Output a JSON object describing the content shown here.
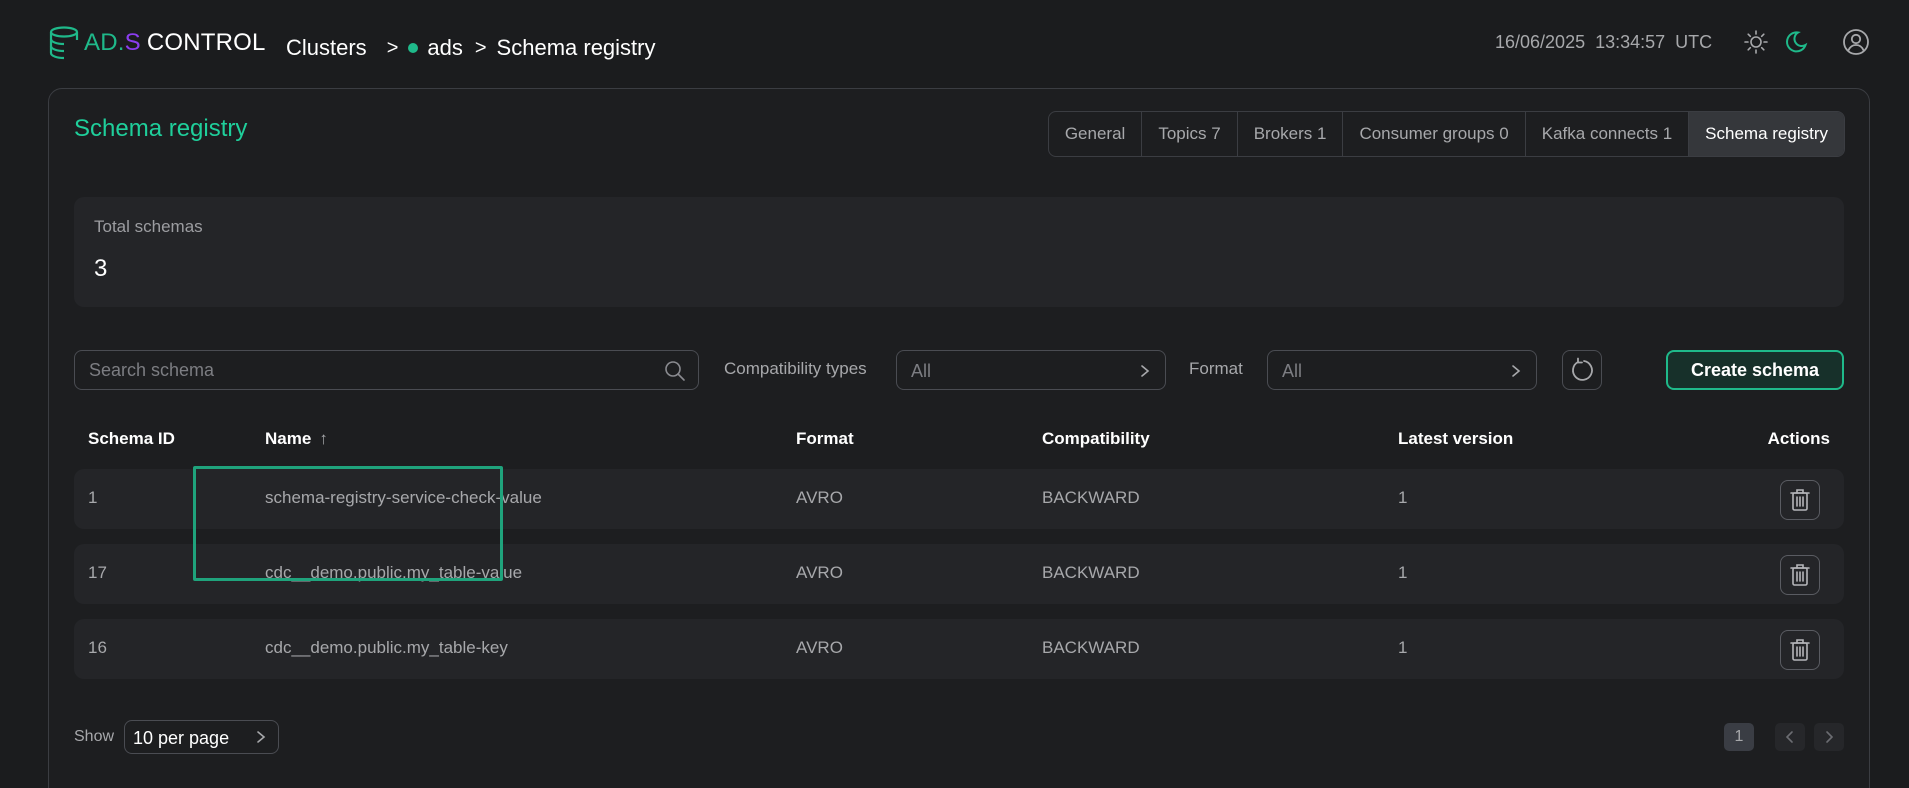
{
  "header": {
    "logo": {
      "ad": "AD.",
      "s": "S",
      "control": "CONTROL"
    },
    "breadcrumb": [
      {
        "label": "Clusters"
      },
      {
        "sep": ">"
      },
      {
        "label": "ads"
      },
      {
        "sep": ">"
      },
      {
        "label": "Schema registry"
      }
    ],
    "date": "16/06/2025",
    "time": "13:34:57",
    "tz": "UTC",
    "icons": [
      "sun-icon",
      "moon-icon",
      "user-icon"
    ]
  },
  "page": {
    "title": "Schema registry"
  },
  "tabs": [
    {
      "label": "General",
      "active": false
    },
    {
      "label": "Topics 7",
      "active": false
    },
    {
      "label": "Brokers 1",
      "active": false
    },
    {
      "label": "Consumer groups 0",
      "active": false
    },
    {
      "label": "Kafka connects 1",
      "active": false
    },
    {
      "label": "Schema registry",
      "active": true
    }
  ],
  "summary": {
    "label": "Total schemas",
    "value": "3"
  },
  "filters": {
    "search_placeholder": "Search schema",
    "compat_label": "Compatibility types",
    "compat_value": "All",
    "format_label": "Format",
    "format_value": "All",
    "create_label": "Create schema"
  },
  "table": {
    "headers": {
      "id": "Schema ID",
      "name": "Name",
      "sort_arrow": "↑",
      "format": "Format",
      "compat": "Compatibility",
      "version": "Latest version",
      "actions": "Actions"
    },
    "rows": [
      {
        "id": "1",
        "name": "schema-registry-service-check-value",
        "format": "AVRO",
        "compat": "BACKWARD",
        "version": "1"
      },
      {
        "id": "17",
        "name": "cdc__demo.public.my_table-value",
        "format": "AVRO",
        "compat": "BACKWARD",
        "version": "1"
      },
      {
        "id": "16",
        "name": "cdc__demo.public.my_table-key",
        "format": "AVRO",
        "compat": "BACKWARD",
        "version": "1"
      }
    ]
  },
  "pagination": {
    "show_label": "Show",
    "per_page": "10 per page",
    "current_page": "1"
  },
  "colors": {
    "accent": "#1fcf9b",
    "brand_purple": "#8b3df0",
    "highlight_box": "#1fa37c"
  }
}
